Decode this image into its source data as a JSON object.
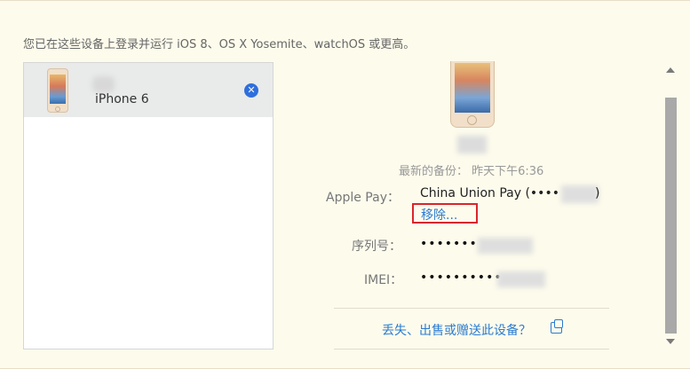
{
  "intro_text": "您已在这些设备上登录并运行 iOS 8、OS X Yosemite、watchOS 或更高。",
  "devices": [
    {
      "name": "iPhone 6",
      "icon": "iphone-icon",
      "selected": true
    }
  ],
  "detail": {
    "last_backup": "最新的备份： 昨天下午6:36",
    "apple_pay_label": "Apple Pay：",
    "apple_pay_value": "China Union Pay (••••",
    "apple_pay_suffix": ")",
    "remove_label": "移除...",
    "serial_label": "序列号：",
    "serial_value": "•••••••",
    "imei_label": "IMEI：",
    "imei_value": "••••••••••",
    "lost_link": "丢失、出售或赠送此设备？"
  },
  "colors": {
    "background": "#fdfbec",
    "link": "#2a7bd2",
    "highlight_border": "#d9262b",
    "remove_badge": "#2f6fdc"
  }
}
